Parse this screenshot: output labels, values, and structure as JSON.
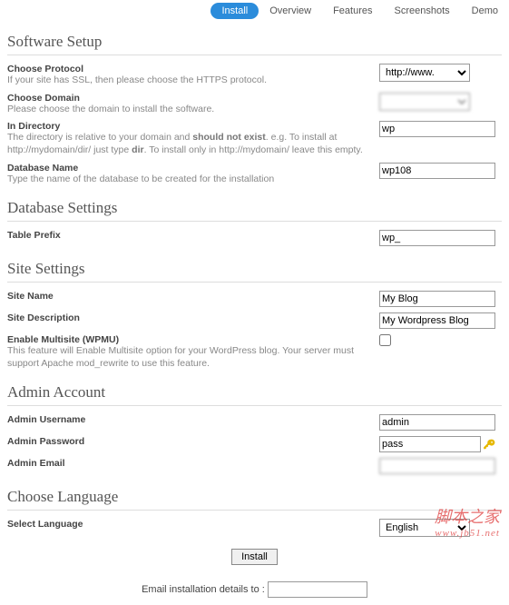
{
  "tabs": {
    "install": "Install",
    "overview": "Overview",
    "features": "Features",
    "screenshots": "Screenshots",
    "demo": "Demo"
  },
  "s1": {
    "title": "Software Setup",
    "protocol_label": "Choose Protocol",
    "protocol_desc": "If your site has SSL, then please choose the HTTPS protocol.",
    "protocol_value": "http://www.",
    "domain_label": "Choose Domain",
    "domain_desc": "Please choose the domain to install the software.",
    "domain_value": "",
    "dir_label": "In Directory",
    "dir_desc1": "The directory is relative to your domain and ",
    "dir_desc_bold": "should not exist",
    "dir_desc2": ". e.g. To install at http://mydomain/dir/ just type ",
    "dir_desc_bold2": "dir",
    "dir_desc3": ". To install only in http://mydomain/ leave this empty.",
    "dir_value": "wp",
    "db_label": "Database Name",
    "db_desc": "Type the name of the database to be created for the installation",
    "db_value": "wp108"
  },
  "s2": {
    "title": "Database Settings",
    "prefix_label": "Table Prefix",
    "prefix_value": "wp_"
  },
  "s3": {
    "title": "Site Settings",
    "name_label": "Site Name",
    "name_value": "My Blog",
    "desc_label": "Site Description",
    "desc_value": "My Wordpress Blog",
    "ms_label": "Enable Multisite (WPMU)",
    "ms_desc": "This feature will Enable Multisite option for your WordPress blog.\nYour server must support Apache mod_rewrite to use this feature."
  },
  "s4": {
    "title": "Admin Account",
    "user_label": "Admin Username",
    "user_value": "admin",
    "pass_label": "Admin Password",
    "pass_value": "pass",
    "email_label": "Admin Email",
    "email_value": ""
  },
  "s5": {
    "title": "Choose Language",
    "lang_label": "Select Language",
    "lang_value": "English"
  },
  "submit": "Install",
  "email_details": "Email installation details to :",
  "watermark": {
    "text": "脚本之家",
    "url": "www.jb51.net"
  }
}
